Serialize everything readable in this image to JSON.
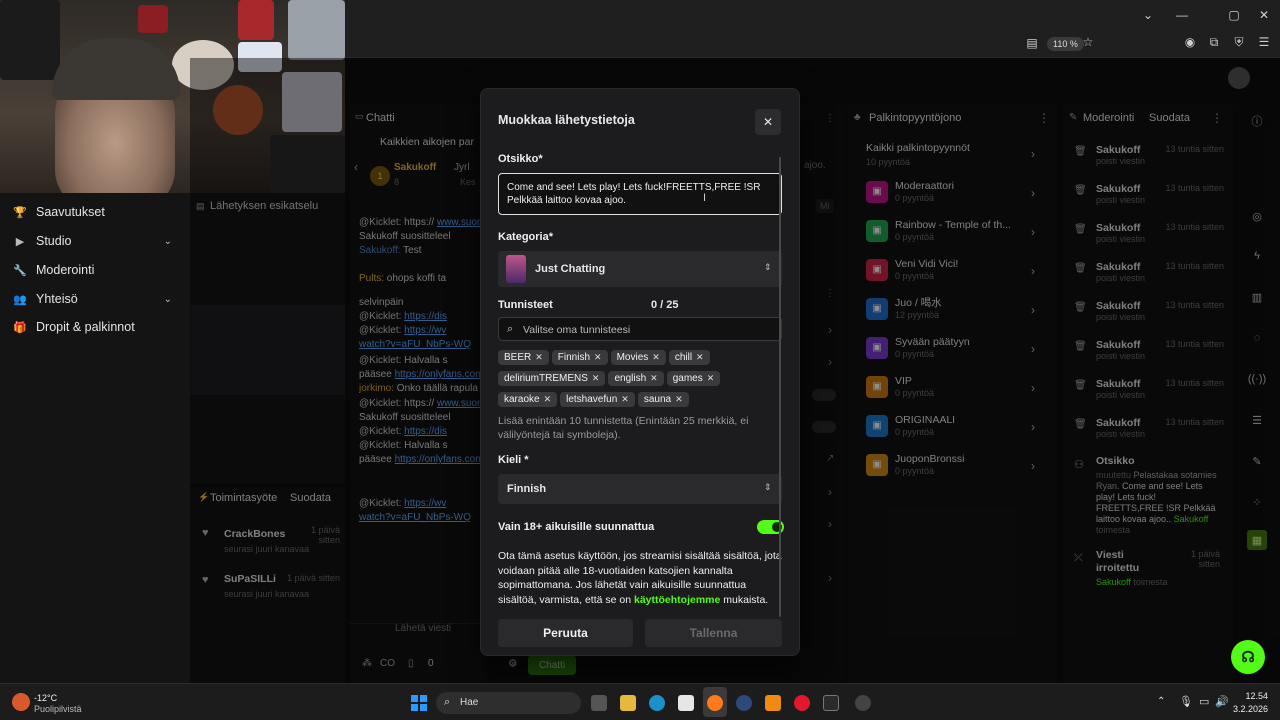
{
  "browser": {
    "zoom": "110 %"
  },
  "sidebar": {
    "items": [
      {
        "label": "Saavutukset",
        "icon": "trophy-icon"
      },
      {
        "label": "Studio",
        "icon": "video-icon"
      },
      {
        "label": "Moderointi",
        "icon": "wrench-icon"
      },
      {
        "label": "Yhteisö",
        "icon": "people-icon"
      },
      {
        "label": "Dropit & palkinnot",
        "icon": "gift-icon"
      }
    ],
    "preview_title": "Lähetyksen esikatselu",
    "activity_title": "Toimintasyöte",
    "activity_filter": "Suodata",
    "activity": [
      {
        "name": "CrackBones",
        "sub": "seurasi juuri kanavaa",
        "time": "1 päivä sitten"
      },
      {
        "name": "SuPaSILLi",
        "sub": "seurasi juuri kanavaa",
        "time": "1 päivä sitten"
      }
    ]
  },
  "chat": {
    "title": "Chatti",
    "top_text": "Kaikkien aikojen par",
    "pinned_user": "Sakukoff",
    "pinned_user2": "Jyrl",
    "pinned_user2b": "Kes",
    "pinned_rank": "1",
    "pinned_count": "8",
    "lines": [
      {
        "user": "@Kicklet:",
        "text": "https://",
        "link": "www.suomalainen.com/pro"
      },
      {
        "text": "Sakukoff suositteleel"
      },
      {
        "user": "Sakukoff:",
        "text": "Test"
      },
      {
        "user": "Pults:",
        "text": "ohops koffi ta"
      },
      {
        "text": "selvinpäin"
      },
      {
        "user": "@Kicklet:",
        "link": "https://dis"
      },
      {
        "user": "@Kicklet:",
        "link": "https://wv"
      },
      {
        "link": "watch?v=aFU_NbPs-WQ"
      },
      {
        "user": "@Kicklet:",
        "text": "Halvalla s"
      },
      {
        "text": "pääsee",
        "link": "https://onlyfans.con"
      },
      {
        "user": "jorkimo:",
        "text": "Onko täällä rapula"
      },
      {
        "user": "@Kicklet:",
        "text": "https://",
        "link": "www.suomalainen.com/pro"
      },
      {
        "text": "Sakukoff suositteleel"
      },
      {
        "user": "@Kicklet:",
        "link": "https://dis"
      },
      {
        "user": "@Kicklet:",
        "text": "Halvalla s"
      },
      {
        "text": "pääsee",
        "link": "https://onlyfans.con"
      },
      {
        "user": "@Kicklet:",
        "link": "https://wv"
      },
      {
        "link": "watch?v=aFU_NbPs-WQ"
      }
    ],
    "input_placeholder": "Lähetä viesti",
    "send_label": "Chatti",
    "viewer_count": "0",
    "bottom_label": "CO"
  },
  "rewards": {
    "title": "Palkintopyyntöjono",
    "all_label": "Kaikki palkintopyynnöt",
    "all_sub": "10 pyyntöä",
    "items": [
      {
        "name": "Moderaattori",
        "sub": "0 pyyntöä",
        "color": "#c0158a"
      },
      {
        "name": "Rainbow - Temple of th...",
        "sub": "0 pyyntöä",
        "color": "#1fa84a"
      },
      {
        "name": "Veni Vidi Vici!",
        "sub": "0 pyyntöä",
        "color": "#d0244a"
      },
      {
        "name": "Juo / 喝水",
        "sub": "12 pyyntöä",
        "color": "#1f6fd0"
      },
      {
        "name": "Syvään päätyyn",
        "sub": "0 pyyntöä",
        "color": "#7a3bd0"
      },
      {
        "name": "VIP",
        "sub": "0 pyyntöä",
        "color": "#d07a12"
      },
      {
        "name": "ORIGINAALI",
        "sub": "0 pyyntöä",
        "color": "#1a7ad0"
      },
      {
        "name": "JuoponBronssi",
        "sub": "0 pyyntöä",
        "color": "#d08a12"
      }
    ]
  },
  "moderation": {
    "title": "Moderointi",
    "filter": "Suodata",
    "items": [
      {
        "name": "Sakukoff",
        "sub": "poisti viestin",
        "time": "13 tuntia sitten"
      },
      {
        "name": "Sakukoff",
        "sub": "poisti viestin",
        "time": "13 tuntia sitten"
      },
      {
        "name": "Sakukoff",
        "sub": "poisti viestin",
        "time": "13 tuntia sitten"
      },
      {
        "name": "Sakukoff",
        "sub": "poisti viestin",
        "time": "13 tuntia sitten"
      },
      {
        "name": "Sakukoff",
        "sub": "poisti viestin",
        "time": "13 tuntia sitten"
      },
      {
        "name": "Sakukoff",
        "sub": "poisti viestin",
        "time": "13 tuntia sitten"
      },
      {
        "name": "Sakukoff",
        "sub": "poisti viestin",
        "time": "13 tuntia sitten"
      },
      {
        "name": "Sakukoff",
        "sub": "poisti viestin",
        "time": "13 tuntia sitten"
      }
    ],
    "title_change": {
      "name": "Otsikko",
      "pre": "muutettu",
      "old": "Pelastakaa sotamies Ryan.",
      "text": "Come and see! Lets play! Lets fuck! FREETTS,FREE !SR Pelkkää laittoo kovaa ajoo..",
      "by": "Sakukoff",
      "by_suffix": "toimesta"
    },
    "unpinned": {
      "name": "Viesti irroitettu",
      "by": "Sakukoff",
      "by_suffix": "toimesta",
      "time": "1 päivä sitten"
    }
  },
  "modal": {
    "title": "Muokkaa lähetystietoja",
    "title_label": "Otsikko*",
    "title_value": "Come and see! Lets play! Lets fuck!FREETTS,FREE !SR Pelkkää laittoo kovaa ajoo.",
    "category_label": "Kategoria*",
    "category_value": "Just Chatting",
    "tags_label": "Tunnisteet",
    "tags_count": "0 / 25",
    "tags_placeholder": "Valitse oma tunnisteesi",
    "tags": [
      "BEER",
      "Finnish",
      "Movies",
      "chill",
      "deliriumTREMENS",
      "english",
      "games",
      "karaoke",
      "letshavefun",
      "sauna"
    ],
    "tags_hint": "Lisää enintään 10 tunnistetta (Enintään 25 merkkiä, ei välilyöntejä tai symboleja).",
    "language_label": "Kieli *",
    "language_value": "Finnish",
    "adult_label": "Vain 18+ aikuisille suunnattua",
    "adult_enabled": true,
    "adult_desc": "Ota tämä asetus käyttöön, jos streamisi sisältää sisältöä, jota voidaan pitää alle 18-vuotiaiden katsojien kannalta sopimattomana. Jos lähetät vain aikuisille suunnattua sisältöä, varmista, että se on",
    "adult_link": "käyttöehtojemme",
    "adult_desc_end": "mukaista.",
    "cancel_label": "Peruuta",
    "save_label": "Tallenna"
  },
  "taskbar": {
    "weather_temp": "-12°C",
    "weather_desc": "Puolipilvistä",
    "search_label": "Hae",
    "time": "12.54",
    "date": "3.2.2026"
  },
  "colors": {
    "accent": "#53fc18",
    "bg": "#0b0b0b",
    "modal": "#1c1c1e"
  }
}
